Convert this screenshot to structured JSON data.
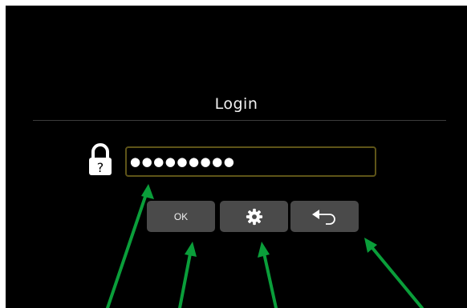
{
  "login": {
    "title": "Login",
    "password_value": "●●●●●●●●●",
    "lock_icon": "lock-question-icon",
    "lock_glyph": "?"
  },
  "buttons": {
    "ok_label": "OK",
    "settings_icon": "gear-icon",
    "back_icon": "back-arrow-icon"
  },
  "annotation": {
    "arrow_color": "#0a9e3a"
  }
}
